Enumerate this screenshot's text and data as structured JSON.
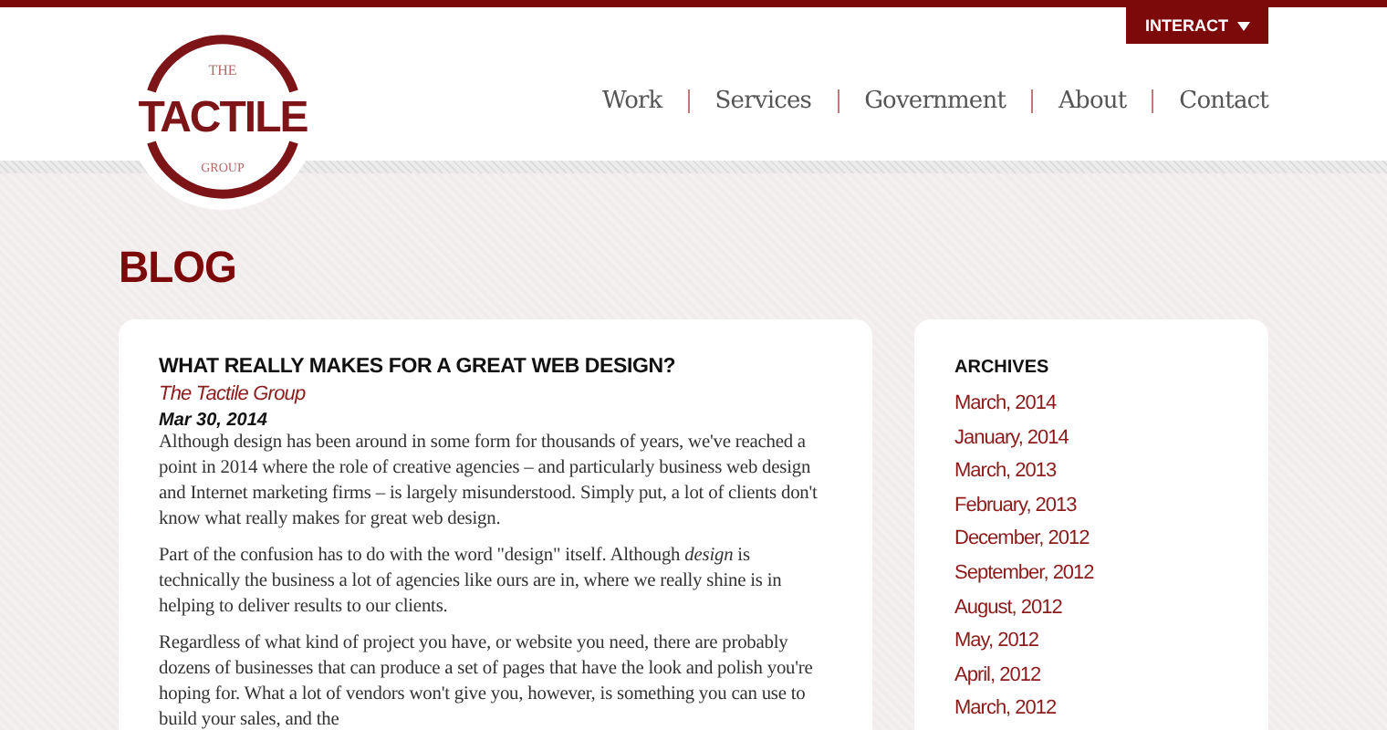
{
  "header": {
    "logo": {
      "top": "THE",
      "main": "TACTILE",
      "bottom": "GROUP"
    },
    "interact_button": {
      "label": "INTERACT"
    },
    "nav": [
      {
        "label": "Work"
      },
      {
        "label": "Services"
      },
      {
        "label": "Government"
      },
      {
        "label": "About"
      },
      {
        "label": "Contact"
      }
    ]
  },
  "page_title": "BLOG",
  "post": {
    "title": "WHAT REALLY MAKES FOR A GREAT WEB DESIGN?",
    "author": "The Tactile Group",
    "date": "Mar 30, 2014",
    "paragraphs": [
      "Although design has been around in some form for thousands of years, we've reached a point in 2014 where the role of creative agencies – and particularly business web design and Internet marketing firms – is largely misunderstood. Simply put, a lot of clients don't know what really makes for great web design.",
      "Part of the confusion has to do with the word \"design\" itself. Although *design* is technically the business a lot of agencies like ours are in, where we really shine is in helping to deliver results to our clients.",
      "Regardless of what kind of project you have, or website you need, there are probably dozens of businesses that can produce a set of pages that have the look and polish you're hoping for. What a lot of vendors won't give you, however, is something you can use to build your sales, and the"
    ]
  },
  "sidebar": {
    "title": "ARCHIVES",
    "links": [
      "March, 2014",
      "January, 2014",
      "March, 2013",
      "February, 2013",
      "December, 2012",
      "September, 2012",
      "August, 2012",
      "May, 2012",
      "April, 2012",
      "March, 2012"
    ]
  }
}
